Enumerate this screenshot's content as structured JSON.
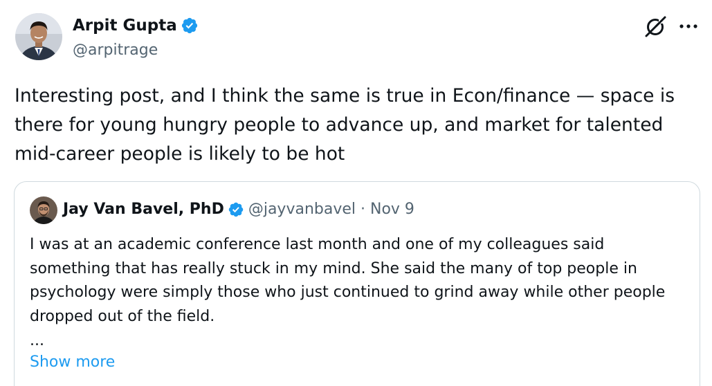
{
  "author": {
    "name": "Arpit Gupta",
    "handle": "@arpitrage",
    "verified": true
  },
  "tweet": {
    "text": "Interesting post, and I think the same is true in Econ/finance — space is there for young hungry people to advance up, and market for talented mid-career people is likely to be hot"
  },
  "quote": {
    "name": "Jay Van Bavel, PhD",
    "handle": "@jayvanbavel",
    "separator": "·",
    "date": "Nov 9",
    "verified": true,
    "text": "I was at an academic conference last month and one of my colleagues said something that has really stuck in my mind. She said the many of top people in psychology were simply those who just continued to grind away while other people dropped out of the field.",
    "ellipsis": "...",
    "show_more_label": "Show more"
  },
  "colors": {
    "accent": "#1d9bf0",
    "text_primary": "#0f1419",
    "text_secondary": "#536471",
    "border": "#cfd9de"
  },
  "icons": {
    "verified": "verified-badge-icon",
    "grok": "grok-icon",
    "more": "more-options-icon"
  }
}
